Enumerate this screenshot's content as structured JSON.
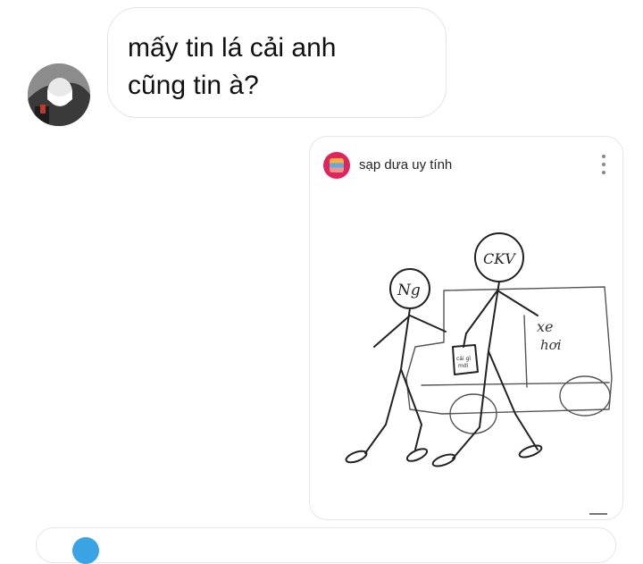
{
  "incoming_message": {
    "text": "mấy tin lá cải anh\ncũng tin à?"
  },
  "shared_post": {
    "username": "sạp dưa uy tính",
    "drawing_labels": {
      "head_left": "Ng",
      "head_right": "CKV",
      "car": "xe\nhơi",
      "bag": "cái gì\nmới"
    }
  },
  "colors": {
    "bubble_border": "#e3e3e3",
    "post_avatar": "#e0245e",
    "ink": "#222222"
  },
  "icons": {
    "more": "vertical-ellipsis",
    "avatar": "user-photo"
  }
}
